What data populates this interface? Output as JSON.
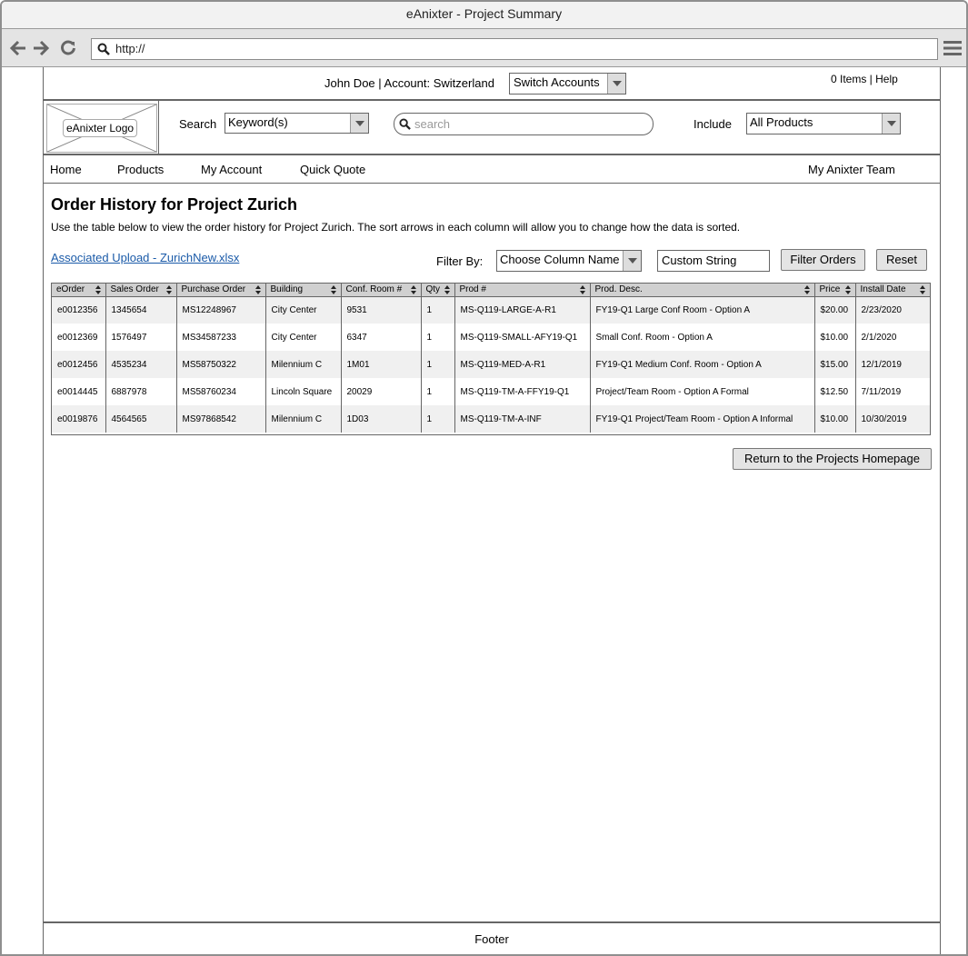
{
  "window": {
    "title": "eAnixter - Project Summary"
  },
  "browser": {
    "url": "http://"
  },
  "account_bar": {
    "account_text": "John Doe | Account: Switzerland",
    "switch_accounts": "Switch Accounts",
    "items_help": "0 Items | Help"
  },
  "header": {
    "logo": "eAnixter Logo",
    "search_label": "Search",
    "keyword_select": "Keyword(s)",
    "search_placeholder": "search",
    "include_label": "Include",
    "products_select": "All Products"
  },
  "nav": {
    "home": "Home",
    "products": "Products",
    "my_account": "My Account",
    "quick_quote": "Quick Quote",
    "my_team": "My Anixter Team"
  },
  "content": {
    "title": "Order History for Project Zurich",
    "description": "Use the table below to view the order history for Project Zurich. The sort arrows in each column will allow you to change how the data is sorted.",
    "upload_link": "Associated Upload - ZurichNew.xlsx",
    "filter_label": "Filter By:",
    "column_select": "Choose Column Name",
    "custom_string": "Custom String",
    "filter_button": "Filter Orders",
    "reset_button": "Reset",
    "return_button": "Return to  the Projects Homepage"
  },
  "table": {
    "columns": [
      "eOrder",
      "Sales Order",
      "Purchase Order",
      "Building",
      "Conf. Room #",
      "Qty",
      "Prod #",
      "Prod. Desc.",
      "Price",
      "Install Date"
    ],
    "rows": [
      [
        "e0012356",
        "1345654",
        "MS12248967",
        "City Center",
        "9531",
        "1",
        "MS-Q119-LARGE-A-R1",
        "FY19-Q1 Large Conf Room - Option A",
        "$20.00",
        "2/23/2020"
      ],
      [
        "e0012369",
        "1576497",
        "MS34587233",
        "City Center",
        "6347",
        "1",
        "MS-Q119-SMALL-AFY19-Q1",
        "Small Conf. Room - Option A",
        "$10.00",
        "2/1/2020"
      ],
      [
        "e0012456",
        "4535234",
        "MS58750322",
        "Milennium C",
        "1M01",
        "1",
        "MS-Q119-MED-A-R1",
        "FY19-Q1 Medium Conf. Room - Option A",
        "$15.00",
        "12/1/2019"
      ],
      [
        "e0014445",
        "6887978",
        "MS58760234",
        "Lincoln Square",
        "20029",
        "1",
        "MS-Q119-TM-A-FFY19-Q1",
        "Project/Team Room - Option A Formal",
        "$12.50",
        "7/11/2019"
      ],
      [
        "e0019876",
        "4564565",
        "MS97868542",
        "Milennium C",
        "1D03",
        "1",
        "MS-Q119-TM-A-INF",
        "FY19-Q1 Project/Team Room - Option A Informal",
        "$10.00",
        "10/30/2019"
      ]
    ]
  },
  "footer": {
    "text": "Footer"
  }
}
